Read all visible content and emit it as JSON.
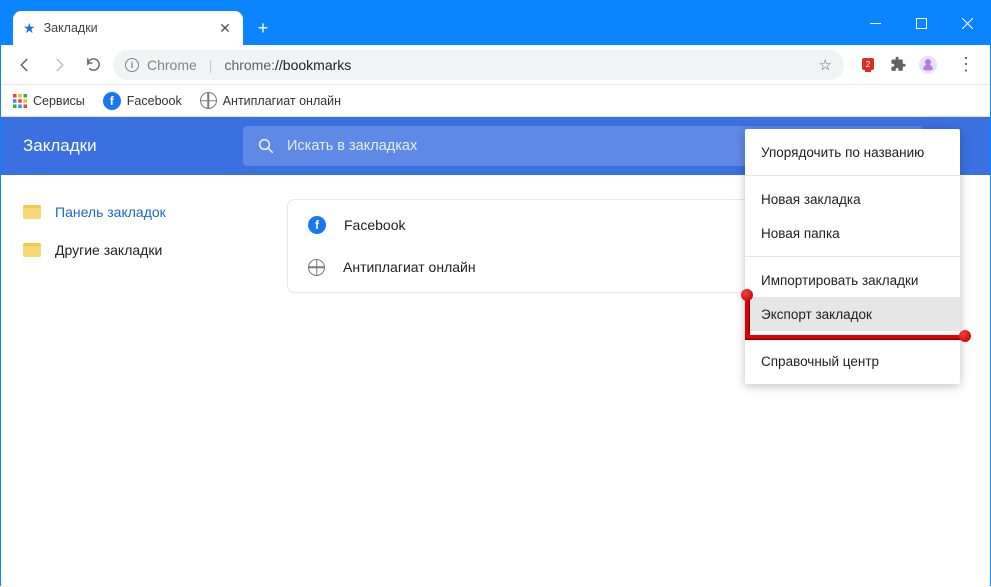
{
  "tab": {
    "title": "Закладки"
  },
  "address": {
    "host_label": "Chrome",
    "url_host": "chrome:",
    "url_path": "//bookmarks"
  },
  "bookmarks_bar": {
    "apps": "Сервисы",
    "items": [
      {
        "label": "Facebook"
      },
      {
        "label": "Антиплагиат онлайн"
      }
    ]
  },
  "manager": {
    "title": "Закладки",
    "search_placeholder": "Искать в закладках",
    "sidebar": [
      {
        "label": "Панель закладок",
        "selected": true
      },
      {
        "label": "Другие закладки",
        "selected": false
      }
    ],
    "list": [
      {
        "label": "Facebook",
        "icon": "facebook"
      },
      {
        "label": "Антиплагиат онлайн",
        "icon": "globe"
      }
    ]
  },
  "menu": {
    "sort": "Упорядочить по названию",
    "new_bookmark": "Новая закладка",
    "new_folder": "Новая папка",
    "import": "Импортировать закладки",
    "export": "Экспорт закладок",
    "help": "Справочный центр"
  }
}
